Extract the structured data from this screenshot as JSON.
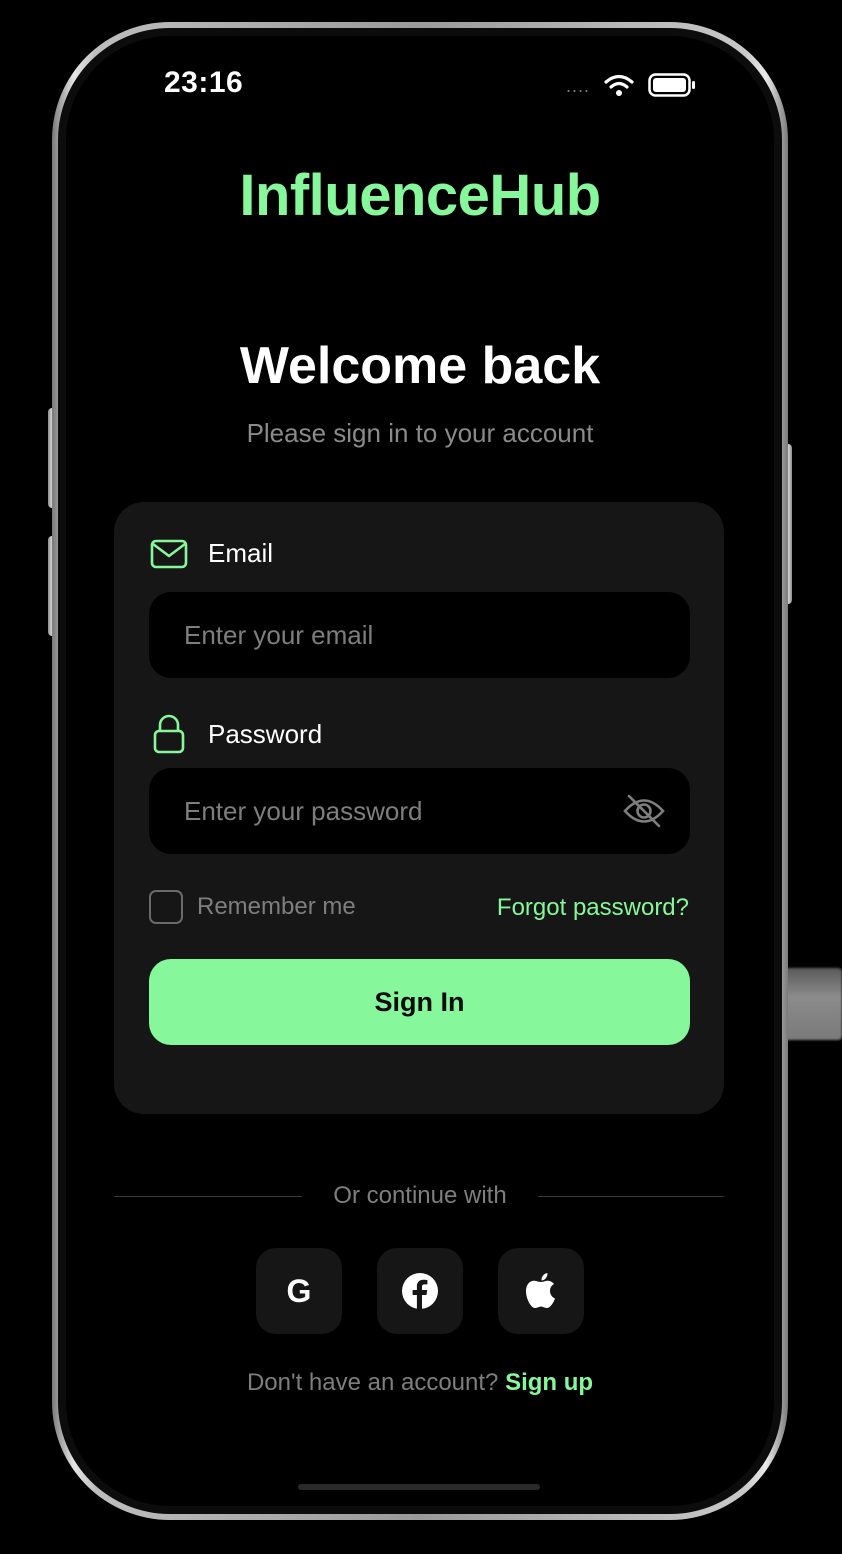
{
  "status_bar": {
    "time": "23:16",
    "signal": "....",
    "wifi_icon": "wifi-icon",
    "battery_icon": "battery-icon"
  },
  "brand": {
    "name": "InfluenceHub",
    "color": "#86f79a"
  },
  "header": {
    "title": "Welcome back",
    "subtitle": "Please sign in to your account"
  },
  "form": {
    "email": {
      "label": "Email",
      "icon": "mail-icon",
      "value": "",
      "placeholder": "Enter your email"
    },
    "password": {
      "label": "Password",
      "icon": "lock-icon",
      "value": "",
      "placeholder": "Enter your password",
      "toggle_icon": "eye-off-icon"
    },
    "remember_me": {
      "label": "Remember me",
      "checked": false
    },
    "forgot_password": "Forgot password?",
    "submit": "Sign In"
  },
  "social": {
    "divider_text": "Or continue with",
    "providers": [
      {
        "name": "Google",
        "glyph": "G",
        "icon": "google-icon"
      },
      {
        "name": "Facebook",
        "icon": "facebook-icon"
      },
      {
        "name": "Apple",
        "icon": "apple-icon"
      }
    ]
  },
  "footer": {
    "prompt": "Don't have an account?",
    "link": "Sign up"
  },
  "colors": {
    "background": "#000000",
    "card": "#161616",
    "accent": "#86f79a",
    "muted_text": "#7e7e7e"
  }
}
